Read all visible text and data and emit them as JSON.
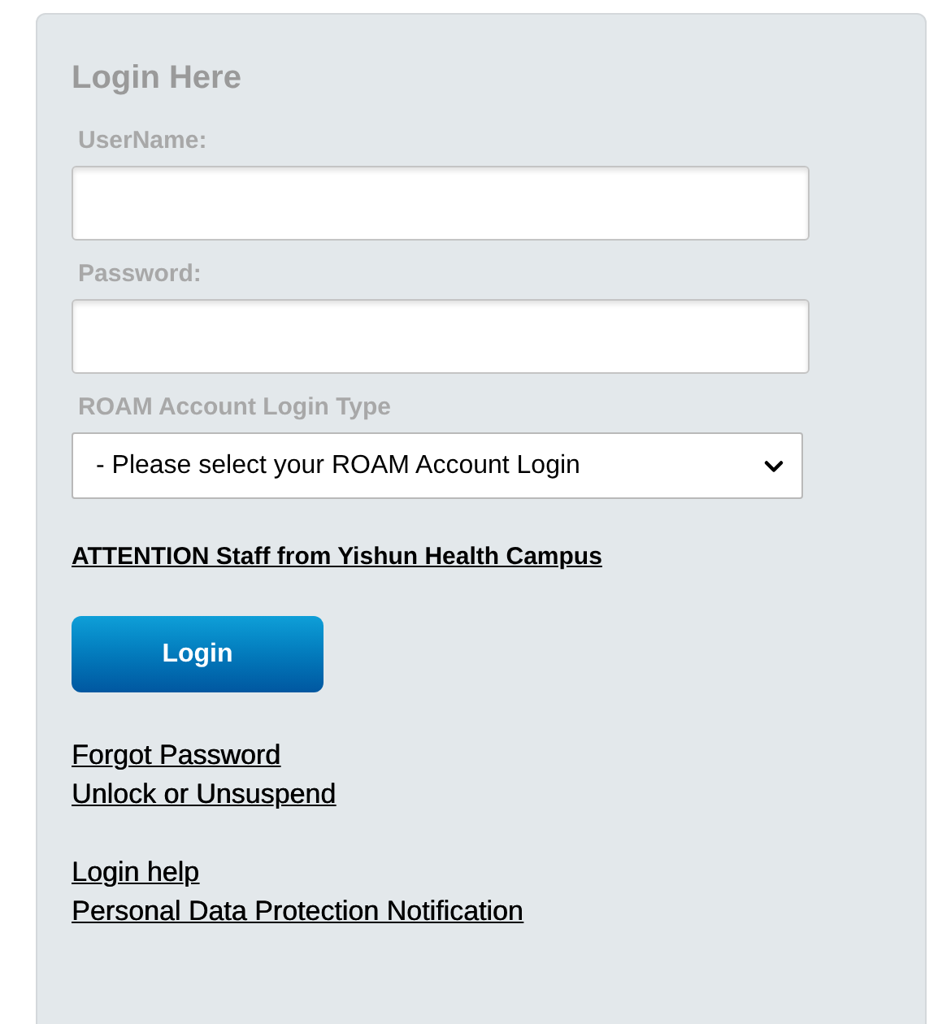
{
  "panel": {
    "title": "Login Here"
  },
  "fields": [
    {
      "kind": "text",
      "label": "UserName:"
    },
    {
      "kind": "password",
      "label": "Password:"
    },
    {
      "kind": "select",
      "label": "ROAM Account Login Type",
      "value": "- Please select your ROAM Account Login"
    }
  ],
  "notice_link": "ATTENTION Staff from Yishun Health Campus",
  "login_button": "Login",
  "link_groups": [
    [
      "Forgot Password",
      "Unlock or Unsuspend"
    ],
    [
      "Login help",
      "Personal Data Protection Notification"
    ]
  ]
}
